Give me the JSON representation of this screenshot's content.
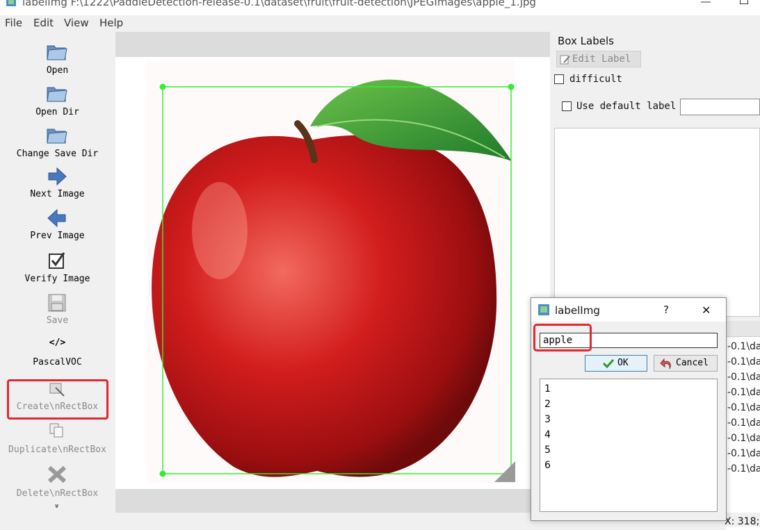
{
  "window": {
    "title": "labelImg F:\\1222\\PaddleDetection-release-0.1\\dataset\\fruit\\fruit-detection\\JPEGImages\\apple_1.jpg"
  },
  "menu": {
    "file": "File",
    "edit": "Edit",
    "view": "View",
    "help": "Help"
  },
  "toolbar": {
    "open": "Open",
    "open_dir": "Open Dir",
    "change_save_dir": "Change Save Dir",
    "next_image": "Next Image",
    "prev_image": "Prev Image",
    "verify_image": "Verify Image",
    "save": "Save",
    "format_icon": "</>",
    "format": "PascalVOC",
    "create_rect": "Create\\nRectBox",
    "duplicate_rect": "Duplicate\\nRectBox",
    "delete_rect": "Delete\\nRectBox",
    "more": "»"
  },
  "box_labels": {
    "title": "Box Labels",
    "edit_label": "Edit Label",
    "difficult": "difficult",
    "use_default_label": "Use default label",
    "default_label_value": ""
  },
  "file_list": {
    "items": [
      "-0.1\\da",
      "-0.1\\da",
      "-0.1\\da",
      "-0.1\\da",
      "-0.1\\da",
      "-0.1\\da",
      "-0.1\\da",
      "-0.1\\da",
      "-0.1\\da"
    ]
  },
  "status": {
    "coords": "X: 318;"
  },
  "dialog": {
    "title": "labelImg",
    "help": "?",
    "close": "✕",
    "input_value": "apple",
    "ok": "OK",
    "cancel": "Cancel",
    "items": [
      "1",
      "2",
      "3",
      "4",
      "5",
      "6"
    ]
  },
  "colors": {
    "bbox": "#33ee33",
    "highlight": "#e0282f"
  },
  "icons": [
    "folder-open-icon",
    "folder-icon",
    "arrow-right-icon",
    "arrow-left-icon",
    "checkbox-icon",
    "floppy-icon",
    "code-icon",
    "rect-create-icon",
    "duplicate-icon",
    "delete-icon",
    "check-icon",
    "undo-icon"
  ]
}
